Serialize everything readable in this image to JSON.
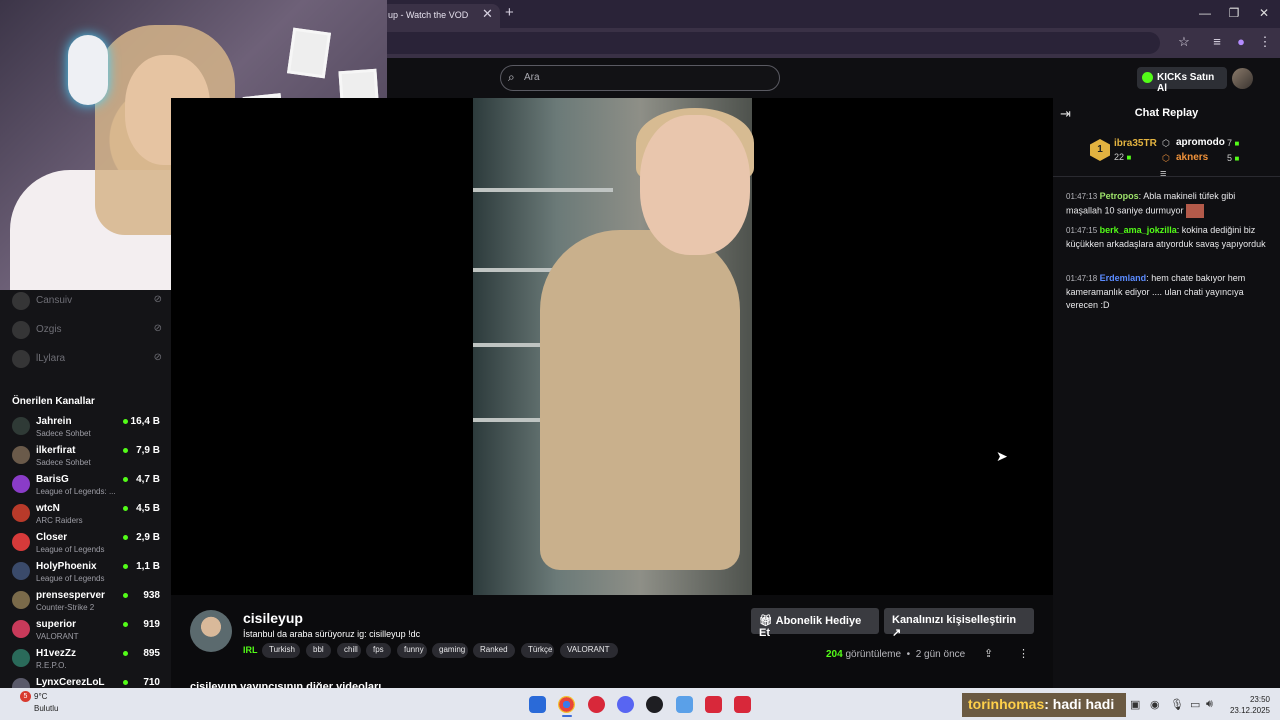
{
  "browser": {
    "tab_title": "up - Watch the VOD",
    "tab_close": "✕",
    "new_tab": "+",
    "window_controls": [
      "—",
      "❐",
      "✕"
    ]
  },
  "site": {
    "search_placeholder": "Ara",
    "kicks_button": "KICKs Satın Al"
  },
  "sidebar": {
    "followed": [
      {
        "name": "Cansuiv"
      },
      {
        "name": "Ozgis"
      },
      {
        "name": "lLylara"
      }
    ],
    "recommended_title": "Önerilen Kanallar",
    "recommended": [
      {
        "name": "Jahrein",
        "category": "Sadece Sohbet",
        "viewers": "16,4 B",
        "color": "#2f3a36"
      },
      {
        "name": "ilkerfirat",
        "category": "Sadece Sohbet",
        "viewers": "7,9 B",
        "color": "#6a5a4a"
      },
      {
        "name": "BarisG",
        "category": "League of Legends: ...",
        "viewers": "4,7 B",
        "color": "#8a3cc8"
      },
      {
        "name": "wtcN",
        "category": "ARC Raiders",
        "viewers": "4,5 B",
        "color": "#b83a2a"
      },
      {
        "name": "Closer",
        "category": "League of Legends",
        "viewers": "2,9 B",
        "color": "#d63a3a"
      },
      {
        "name": "HolyPhoenix",
        "category": "League of Legends",
        "viewers": "1,1 B",
        "color": "#3a4a6a"
      },
      {
        "name": "prensesperver",
        "category": "Counter-Strike 2",
        "viewers": "938",
        "color": "#7a6a4a"
      },
      {
        "name": "superior",
        "category": "VALORANT",
        "viewers": "919",
        "color": "#c83a5a"
      },
      {
        "name": "H1vezZz",
        "category": "R.E.P.O.",
        "viewers": "895",
        "color": "#2a6a5a"
      },
      {
        "name": "LynxCerezLoL",
        "category": "",
        "viewers": "710",
        "color": "#5a5a6a"
      }
    ]
  },
  "chat": {
    "title": "Chat Replay",
    "leaderboard": {
      "first": {
        "rank": "1",
        "name": "ibra35TR",
        "count": "22"
      },
      "second": {
        "name": "apromodo",
        "count": "7"
      },
      "third": {
        "name": "akners",
        "count": "5"
      }
    },
    "messages": [
      {
        "time": "01:47:13",
        "user": "Petropos",
        "color": "#9ee36b",
        "text": "Abla makineli tüfek gibi maşallah 10 saniye durmuyor"
      },
      {
        "time": "01:47:15",
        "user": "berk_ama_jokzilla",
        "color": "#53fc18",
        "text": "kokina dediğini biz küçükken arkadaşlara atıyorduk savaş yapıyorduk"
      },
      {
        "time": "01:47:18",
        "user": "Erdemland",
        "color": "#5b8bff",
        "text": "hem chate bakıyor hem kameramanlık ediyor .... ulan chati yayıncıya verecen :D"
      }
    ]
  },
  "channel": {
    "name": "cisileyup",
    "title": "İstanbul da araba sürüyoruz  ig: cisilleyup !dc",
    "category": "IRL",
    "tags": [
      "Turkish",
      "bbl",
      "chill",
      "fps",
      "funny",
      "gaming",
      "Ranked",
      "Türkçe",
      "VALORANT"
    ],
    "gift_button": "Abonelik Hediye Et",
    "customize_button": "Kanalınızı kişiselleştirin",
    "views": "204",
    "views_label": "görüntüleme",
    "separator": "•",
    "age": "2 gün önce",
    "other_videos": "cisileyup yayıncısının diğer videoları"
  },
  "taskbar": {
    "weather_badge": "5",
    "temperature": "9°C",
    "condition": "Bulutlu",
    "overlay_user": "torinhomas",
    "overlay_text": ": hadi hadi",
    "time": "23:50",
    "date": "23.12.2025"
  }
}
